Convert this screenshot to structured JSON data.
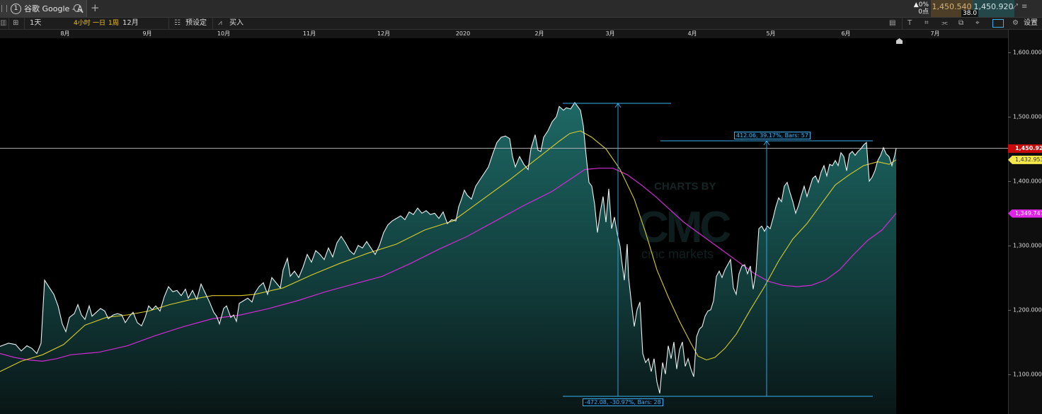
{
  "tab": {
    "number": "1",
    "title": "谷歌 Google - A"
  },
  "stats": {
    "change_pct": "▲0%",
    "change_pts": "0点",
    "bid": "1,450.540",
    "ask": "1,450.920",
    "spread": "38.0"
  },
  "toolbar": {
    "timeframe": "1天",
    "tf_4h": "4小时",
    "tf_1d": "一日",
    "tf_1w": "1周",
    "range": "12月",
    "presets": "预设定",
    "buy": "买入",
    "settings": "设置",
    "font": "T"
  },
  "watermark": {
    "line1": "CHARTS BY",
    "line2": "CMC",
    "line3": "cmc markets"
  },
  "colors": {
    "price_line": "#e8f2f2",
    "area_top": "#1f6e6a",
    "ma_fast": "#d8cc2a",
    "ma_slow": "#d22ad6",
    "measure": "#3ab0f0",
    "last_price_badge": "#c90a0a"
  },
  "measures": {
    "down_label": "-472.08, -30.97%, Bars: 28",
    "up_label": "412.06, 39.17%, Bars: 57"
  },
  "badges": {
    "last_price": "1,450.920",
    "ma_fast": "1,432.953",
    "ma_slow": "1,349.747"
  },
  "chart_data": {
    "type": "area",
    "instrument": "谷歌 Google - A",
    "x_ticks": [
      "8月",
      "9月",
      "10月",
      "11月",
      "12月",
      "2020",
      "2月",
      "3月",
      "4月",
      "5月",
      "6月",
      "7月"
    ],
    "y_ticks": [
      "1,100.000",
      "1,200.000",
      "1,300.000",
      "1,400.000",
      "1,500.000",
      "1,600.000"
    ],
    "ylim": [
      1038,
      1622
    ],
    "price": [
      [
        0,
        1143
      ],
      [
        12,
        1148
      ],
      [
        22,
        1146
      ],
      [
        30,
        1136
      ],
      [
        38,
        1144
      ],
      [
        45,
        1140
      ],
      [
        52,
        1132
      ],
      [
        58,
        1148
      ],
      [
        63,
        1246
      ],
      [
        70,
        1234
      ],
      [
        76,
        1224
      ],
      [
        82,
        1206
      ],
      [
        88,
        1178
      ],
      [
        93,
        1166
      ],
      [
        98,
        1188
      ],
      [
        105,
        1194
      ],
      [
        110,
        1208
      ],
      [
        115,
        1192
      ],
      [
        120,
        1185
      ],
      [
        126,
        1206
      ],
      [
        130,
        1190
      ],
      [
        136,
        1196
      ],
      [
        142,
        1202
      ],
      [
        148,
        1198
      ],
      [
        153,
        1186
      ],
      [
        160,
        1192
      ],
      [
        166,
        1194
      ],
      [
        172,
        1192
      ],
      [
        177,
        1180
      ],
      [
        183,
        1190
      ],
      [
        188,
        1196
      ],
      [
        194,
        1180
      ],
      [
        200,
        1175
      ],
      [
        205,
        1188
      ],
      [
        210,
        1206
      ],
      [
        215,
        1200
      ],
      [
        220,
        1206
      ],
      [
        226,
        1198
      ],
      [
        232,
        1220
      ],
      [
        238,
        1236
      ],
      [
        244,
        1228
      ],
      [
        250,
        1230
      ],
      [
        256,
        1222
      ],
      [
        262,
        1232
      ],
      [
        266,
        1218
      ],
      [
        272,
        1230
      ],
      [
        278,
        1216
      ],
      [
        284,
        1240
      ],
      [
        290,
        1226
      ],
      [
        296,
        1212
      ],
      [
        302,
        1196
      ],
      [
        306,
        1190
      ],
      [
        310,
        1178
      ],
      [
        316,
        1202
      ],
      [
        320,
        1206
      ],
      [
        326,
        1188
      ],
      [
        330,
        1192
      ],
      [
        334,
        1182
      ],
      [
        338,
        1210
      ],
      [
        344,
        1214
      ],
      [
        350,
        1218
      ],
      [
        356,
        1212
      ],
      [
        360,
        1226
      ],
      [
        366,
        1236
      ],
      [
        372,
        1242
      ],
      [
        378,
        1224
      ],
      [
        384,
        1250
      ],
      [
        390,
        1242
      ],
      [
        396,
        1234
      ],
      [
        400,
        1262
      ],
      [
        406,
        1280
      ],
      [
        410,
        1252
      ],
      [
        416,
        1260
      ],
      [
        422,
        1250
      ],
      [
        428,
        1266
      ],
      [
        434,
        1286
      ],
      [
        440,
        1274
      ],
      [
        446,
        1292
      ],
      [
        452,
        1286
      ],
      [
        458,
        1278
      ],
      [
        464,
        1296
      ],
      [
        470,
        1282
      ],
      [
        476,
        1304
      ],
      [
        482,
        1314
      ],
      [
        488,
        1304
      ],
      [
        494,
        1292
      ],
      [
        500,
        1286
      ],
      [
        506,
        1300
      ],
      [
        512,
        1296
      ],
      [
        518,
        1306
      ],
      [
        524,
        1296
      ],
      [
        530,
        1286
      ],
      [
        536,
        1300
      ],
      [
        542,
        1320
      ],
      [
        548,
        1332
      ],
      [
        554,
        1338
      ],
      [
        560,
        1342
      ],
      [
        566,
        1346
      ],
      [
        572,
        1340
      ],
      [
        578,
        1352
      ],
      [
        584,
        1348
      ],
      [
        590,
        1358
      ],
      [
        596,
        1350
      ],
      [
        602,
        1354
      ],
      [
        608,
        1348
      ],
      [
        614,
        1350
      ],
      [
        620,
        1342
      ],
      [
        626,
        1352
      ],
      [
        632,
        1334
      ],
      [
        638,
        1340
      ],
      [
        644,
        1338
      ],
      [
        648,
        1360
      ],
      [
        652,
        1372
      ],
      [
        656,
        1386
      ],
      [
        660,
        1378
      ],
      [
        666,
        1372
      ],
      [
        672,
        1392
      ],
      [
        678,
        1402
      ],
      [
        684,
        1412
      ],
      [
        690,
        1422
      ],
      [
        696,
        1442
      ],
      [
        702,
        1460
      ],
      [
        708,
        1468
      ],
      [
        714,
        1470
      ],
      [
        720,
        1466
      ],
      [
        724,
        1438
      ],
      [
        728,
        1422
      ],
      [
        734,
        1438
      ],
      [
        740,
        1426
      ],
      [
        746,
        1418
      ],
      [
        750,
        1450
      ],
      [
        756,
        1472
      ],
      [
        760,
        1448
      ],
      [
        764,
        1446
      ],
      [
        768,
        1468
      ],
      [
        774,
        1478
      ],
      [
        780,
        1492
      ],
      [
        786,
        1500
      ],
      [
        790,
        1516
      ],
      [
        796,
        1510
      ],
      [
        800,
        1514
      ],
      [
        806,
        1512
      ],
      [
        812,
        1522
      ],
      [
        816,
        1516
      ],
      [
        820,
        1510
      ],
      [
        824,
        1486
      ],
      [
        828,
        1440
      ],
      [
        832,
        1398
      ],
      [
        836,
        1392
      ],
      [
        840,
        1364
      ],
      [
        844,
        1320
      ],
      [
        848,
        1352
      ],
      [
        852,
        1376
      ],
      [
        856,
        1336
      ],
      [
        860,
        1388
      ],
      [
        864,
        1326
      ],
      [
        868,
        1344
      ],
      [
        872,
        1318
      ],
      [
        876,
        1298
      ],
      [
        878,
        1278
      ],
      [
        882,
        1246
      ],
      [
        886,
        1302
      ],
      [
        888,
        1250
      ],
      [
        892,
        1210
      ],
      [
        896,
        1174
      ],
      [
        900,
        1200
      ],
      [
        904,
        1212
      ],
      [
        908,
        1132
      ],
      [
        912,
        1118
      ],
      [
        916,
        1124
      ],
      [
        920,
        1104
      ],
      [
        924,
        1124
      ],
      [
        928,
        1088
      ],
      [
        932,
        1070
      ],
      [
        936,
        1118
      ],
      [
        940,
        1100
      ],
      [
        944,
        1144
      ],
      [
        948,
        1124
      ],
      [
        952,
        1150
      ],
      [
        956,
        1108
      ],
      [
        960,
        1138
      ],
      [
        964,
        1150
      ],
      [
        968,
        1112
      ],
      [
        972,
        1124
      ],
      [
        976,
        1108
      ],
      [
        980,
        1096
      ],
      [
        984,
        1158
      ],
      [
        988,
        1170
      ],
      [
        992,
        1174
      ],
      [
        996,
        1190
      ],
      [
        1000,
        1198
      ],
      [
        1004,
        1200
      ],
      [
        1008,
        1214
      ],
      [
        1012,
        1252
      ],
      [
        1016,
        1260
      ],
      [
        1020,
        1250
      ],
      [
        1024,
        1262
      ],
      [
        1028,
        1270
      ],
      [
        1032,
        1278
      ],
      [
        1036,
        1234
      ],
      [
        1040,
        1224
      ],
      [
        1044,
        1256
      ],
      [
        1048,
        1268
      ],
      [
        1052,
        1270
      ],
      [
        1056,
        1256
      ],
      [
        1060,
        1268
      ],
      [
        1064,
        1232
      ],
      [
        1068,
        1260
      ],
      [
        1072,
        1326
      ],
      [
        1076,
        1330
      ],
      [
        1080,
        1322
      ],
      [
        1084,
        1330
      ],
      [
        1088,
        1326
      ],
      [
        1092,
        1342
      ],
      [
        1096,
        1360
      ],
      [
        1100,
        1374
      ],
      [
        1104,
        1368
      ],
      [
        1108,
        1392
      ],
      [
        1112,
        1398
      ],
      [
        1116,
        1382
      ],
      [
        1120,
        1368
      ],
      [
        1124,
        1350
      ],
      [
        1128,
        1362
      ],
      [
        1132,
        1378
      ],
      [
        1136,
        1392
      ],
      [
        1140,
        1376
      ],
      [
        1144,
        1390
      ],
      [
        1148,
        1404
      ],
      [
        1152,
        1408
      ],
      [
        1156,
        1398
      ],
      [
        1160,
        1414
      ],
      [
        1164,
        1424
      ],
      [
        1168,
        1408
      ],
      [
        1172,
        1426
      ],
      [
        1176,
        1424
      ],
      [
        1180,
        1432
      ],
      [
        1184,
        1424
      ],
      [
        1188,
        1444
      ],
      [
        1192,
        1438
      ],
      [
        1196,
        1416
      ],
      [
        1200,
        1442
      ],
      [
        1204,
        1446
      ],
      [
        1208,
        1440
      ],
      [
        1212,
        1446
      ],
      [
        1216,
        1450
      ],
      [
        1220,
        1456
      ],
      [
        1224,
        1460
      ],
      [
        1228,
        1400
      ],
      [
        1232,
        1406
      ],
      [
        1236,
        1416
      ],
      [
        1240,
        1432
      ],
      [
        1244,
        1440
      ],
      [
        1248,
        1452
      ],
      [
        1252,
        1442
      ],
      [
        1256,
        1438
      ],
      [
        1260,
        1424
      ],
      [
        1264,
        1440
      ],
      [
        1266,
        1451
      ]
    ],
    "ma_fast": [
      [
        0,
        1104
      ],
      [
        30,
        1120
      ],
      [
        60,
        1130
      ],
      [
        90,
        1146
      ],
      [
        120,
        1176
      ],
      [
        150,
        1188
      ],
      [
        180,
        1192
      ],
      [
        210,
        1198
      ],
      [
        240,
        1208
      ],
      [
        270,
        1216
      ],
      [
        300,
        1222
      ],
      [
        320,
        1222
      ],
      [
        340,
        1222
      ],
      [
        360,
        1224
      ],
      [
        400,
        1234
      ],
      [
        440,
        1254
      ],
      [
        480,
        1272
      ],
      [
        520,
        1288
      ],
      [
        560,
        1302
      ],
      [
        600,
        1324
      ],
      [
        640,
        1338
      ],
      [
        680,
        1370
      ],
      [
        720,
        1402
      ],
      [
        760,
        1436
      ],
      [
        790,
        1462
      ],
      [
        805,
        1474
      ],
      [
        820,
        1478
      ],
      [
        836,
        1468
      ],
      [
        856,
        1450
      ],
      [
        876,
        1418
      ],
      [
        896,
        1372
      ],
      [
        912,
        1320
      ],
      [
        928,
        1262
      ],
      [
        944,
        1220
      ],
      [
        960,
        1182
      ],
      [
        976,
        1148
      ],
      [
        986,
        1128
      ],
      [
        998,
        1122
      ],
      [
        1010,
        1126
      ],
      [
        1024,
        1140
      ],
      [
        1040,
        1162
      ],
      [
        1060,
        1200
      ],
      [
        1080,
        1236
      ],
      [
        1100,
        1276
      ],
      [
        1120,
        1310
      ],
      [
        1140,
        1334
      ],
      [
        1160,
        1364
      ],
      [
        1180,
        1394
      ],
      [
        1200,
        1410
      ],
      [
        1220,
        1424
      ],
      [
        1240,
        1430
      ],
      [
        1256,
        1426
      ],
      [
        1266,
        1433
      ]
    ],
    "ma_slow": [
      [
        0,
        1132
      ],
      [
        20,
        1126
      ],
      [
        40,
        1122
      ],
      [
        60,
        1120
      ],
      [
        80,
        1124
      ],
      [
        100,
        1130
      ],
      [
        140,
        1134
      ],
      [
        180,
        1144
      ],
      [
        220,
        1160
      ],
      [
        260,
        1174
      ],
      [
        300,
        1186
      ],
      [
        340,
        1192
      ],
      [
        380,
        1202
      ],
      [
        420,
        1214
      ],
      [
        460,
        1228
      ],
      [
        500,
        1240
      ],
      [
        540,
        1252
      ],
      [
        580,
        1272
      ],
      [
        620,
        1294
      ],
      [
        660,
        1314
      ],
      [
        700,
        1338
      ],
      [
        740,
        1362
      ],
      [
        780,
        1384
      ],
      [
        810,
        1406
      ],
      [
        826,
        1418
      ],
      [
        846,
        1420
      ],
      [
        866,
        1420
      ],
      [
        886,
        1410
      ],
      [
        906,
        1394
      ],
      [
        926,
        1376
      ],
      [
        946,
        1356
      ],
      [
        966,
        1336
      ],
      [
        986,
        1320
      ],
      [
        1006,
        1304
      ],
      [
        1026,
        1288
      ],
      [
        1046,
        1272
      ],
      [
        1066,
        1256
      ],
      [
        1086,
        1244
      ],
      [
        1106,
        1238
      ],
      [
        1126,
        1236
      ],
      [
        1146,
        1238
      ],
      [
        1166,
        1246
      ],
      [
        1186,
        1262
      ],
      [
        1206,
        1286
      ],
      [
        1226,
        1308
      ],
      [
        1246,
        1324
      ],
      [
        1266,
        1350
      ]
    ],
    "last_price": 1450.92
  }
}
